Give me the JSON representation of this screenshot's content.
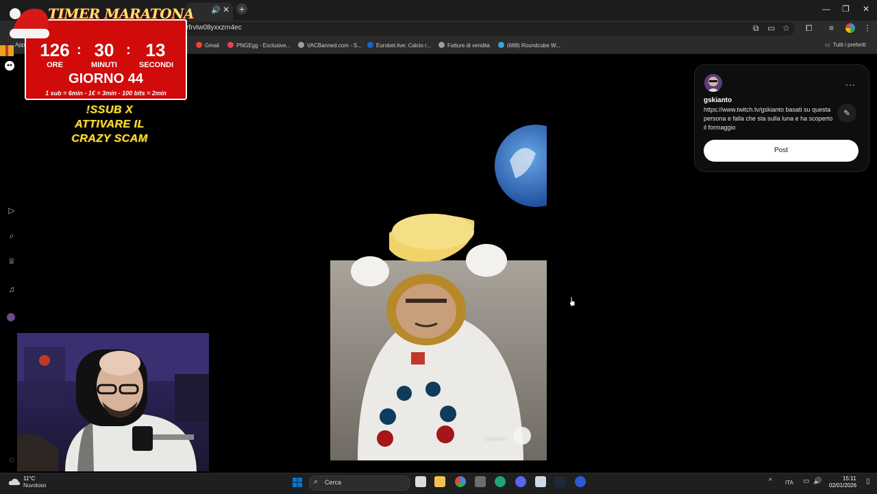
{
  "browser": {
    "url": "rfrvtw08yxxzrn4ec",
    "tab_audio_icon": "speaker-icon",
    "new_tab_label": "+",
    "bookmarks": [
      {
        "label": "Gmail",
        "icon": "gmail-icon",
        "color": "#ea4335"
      },
      {
        "label": "PNGEgg - Exclusive...",
        "icon": "pngegg-icon",
        "color": "#e4405f"
      },
      {
        "label": "VACBanned.com - S...",
        "icon": "globe-icon",
        "color": "#9e9e9e"
      },
      {
        "label": "Eurobet.live: Calcio r...",
        "icon": "eurobet-icon",
        "color": "#1e63c8"
      },
      {
        "label": "Fatture di vendita",
        "icon": "globe-icon",
        "color": "#9e9e9e"
      },
      {
        "label": "(688) Roundcube W...",
        "icon": "roundcube-icon",
        "color": "#37a6d9"
      }
    ],
    "bookmarks_folder": "Tutti i preferiti",
    "bookmark_cut_label": "App"
  },
  "overlay": {
    "timer_title": "TIMER MARATONA",
    "hours": "126",
    "minutes": "30",
    "seconds": "13",
    "hours_unit": "ORE",
    "minutes_unit": "MINUTI",
    "seconds_unit": "SECONDI",
    "day": "GIORNO 44",
    "rates": "1 sub = 6min - 1€ = 3min - 100 bits = 2min",
    "sub_text_1": "!SSUB X",
    "sub_text_2": "ATTIVARE IL",
    "sub_text_3": "CRAZY SCAM",
    "colors": {
      "timer_bg": "#d10a0a",
      "title": "#ffe16b",
      "sub_text": "#ffe236"
    }
  },
  "video": {
    "watermark": "Sora",
    "handle": "@gskianto"
  },
  "prompt_card": {
    "username": "gskianto",
    "prompt": "https://www.twitch.tv/gskianto basati su questa persona e falla che sta sulla luna e ha scoperto il formaggio",
    "post_label": "Post",
    "more_label": "...",
    "edit_icon": "pencil-icon"
  },
  "taskbar": {
    "weather_temp": "11°C",
    "weather_desc": "Nuvoloso",
    "search_placeholder": "Cerca",
    "language": "ITA",
    "time": "15:11",
    "date": "02/01/2026",
    "accent": "#0078d4"
  }
}
